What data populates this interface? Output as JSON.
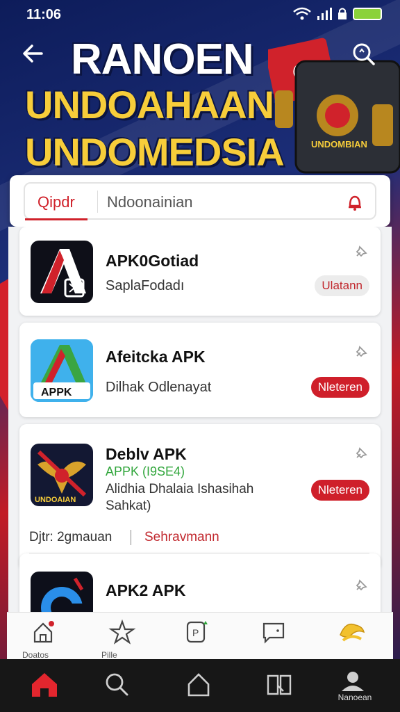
{
  "status_bar": {
    "time": "11:06"
  },
  "header": {
    "title_line1": "RANOEN",
    "title_line2": "UNDOAHAAN",
    "title_line3": "UNDOMEDSIA",
    "hero_caption": "UNDOMBIAN",
    "colors": {
      "accent": "#d0222b",
      "gold": "#f7cd3a",
      "navy": "#0d1c5a"
    }
  },
  "search": {
    "category": "Qipdr",
    "placeholder": "Ndoonainian"
  },
  "apps": [
    {
      "name": "APK0Gotiad",
      "subtitle": "SaplaFodadı",
      "button": "Ulatann",
      "button_style": "grey",
      "icon": "apk-a-icon"
    },
    {
      "name": "Afeitcka APK",
      "icon_label": "APPK",
      "subtitle": "Dilhak Odlenayat",
      "button": "Nleteren",
      "button_style": "red",
      "icon": "green-a-icon"
    },
    {
      "name": "Deblv APK",
      "icon_label": "UNDOAIAN",
      "version": "APPK (I9SE4)",
      "desc_line1": "Alidhia Dhalaia Ishasihah",
      "desc_line2": "Sahkat)",
      "button": "Nleteren",
      "button_style": "red",
      "meta_left": "Djtr: 2gmauan",
      "meta_right": "Sehravmann",
      "icon": "garuda-icon"
    },
    {
      "name": "APK2 APK",
      "icon": "blue-g-icon"
    }
  ],
  "tabbar": {
    "tabs": [
      {
        "icon": "home-outline-icon",
        "label": "Doatos"
      },
      {
        "icon": "star-outline-icon",
        "label": "Pille"
      },
      {
        "icon": "p-badge-icon",
        "label": ""
      },
      {
        "icon": "chat-icon",
        "label": ""
      },
      {
        "icon": "trophy-icon",
        "label": ""
      }
    ]
  },
  "navbar": {
    "items": [
      {
        "icon": "home-icon",
        "label": ""
      },
      {
        "icon": "search-icon",
        "label": ""
      },
      {
        "icon": "house-outline-icon",
        "label": ""
      },
      {
        "icon": "book-icon",
        "label": ""
      },
      {
        "icon": "profile-icon",
        "label": "Nanoean"
      }
    ]
  }
}
